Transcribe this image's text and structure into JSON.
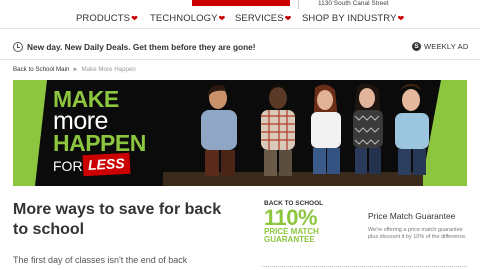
{
  "header": {
    "address": "1130 South Canal Street"
  },
  "nav": {
    "items": [
      {
        "label": "PRODUCTS",
        "icon": "heart-icon"
      },
      {
        "label": "TECHNOLOGY",
        "icon": "heart-icon"
      },
      {
        "label": "SERVICES",
        "icon": "heart-icon"
      },
      {
        "label": "SHOP BY INDUSTRY",
        "icon": "heart-icon"
      }
    ],
    "heart_glyph": "❤"
  },
  "dealbar": {
    "text": "New day. New Daily Deals. Get them before they are gone!",
    "weekly_ad_badge": "S",
    "weekly_ad_label": "WEEKLY AD"
  },
  "breadcrumb": {
    "items": [
      "Back to School Main",
      "Make More Happen"
    ],
    "separator": "►"
  },
  "hero": {
    "line1": "MAKE",
    "line2": "more",
    "line3": "HAPPEN",
    "for_text": "FOR",
    "less_text": "LESS"
  },
  "main": {
    "headline": "More ways to save for back to school",
    "intro": "The first day of classes isn't the end of back"
  },
  "price_match": {
    "logo_top": "BACK TO SCHOOL",
    "logo_percent": "110%",
    "logo_line1": "PRICE MATCH",
    "logo_line2": "GUARANTEE",
    "title": "Price Match Guarantee",
    "text": "We're offering a price match guarantee plus discount it by 10% of the difference."
  },
  "colors": {
    "brand_red": "#cc0000",
    "accent_green": "#8cc63f",
    "text": "#333333"
  }
}
